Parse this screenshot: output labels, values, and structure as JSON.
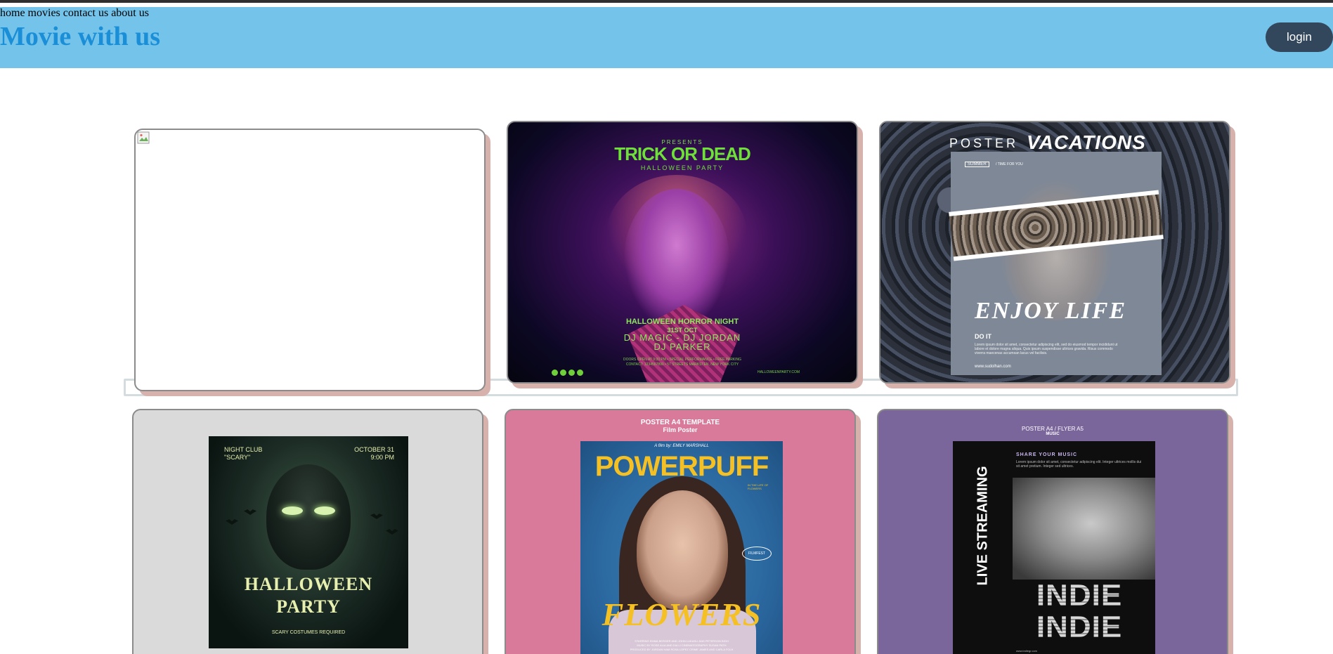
{
  "header": {
    "brand": "Movie with us",
    "nav": [
      {
        "label": "home"
      },
      {
        "label": "movies"
      },
      {
        "label": "contact us"
      },
      {
        "label": "about us"
      }
    ],
    "login_label": "login",
    "colors": {
      "bar": "#74c3ea",
      "brand": "#1a8fd8",
      "nav": "#2a62b0",
      "login_bg": "#33475c"
    }
  },
  "posters": [
    {
      "kind": "broken-image"
    },
    {
      "kind": "trick-or-dead",
      "presents": "PRESENTS",
      "title": "TRICK OR DEAD",
      "subtitle": "HALLOWEEN PARTY",
      "event": "HALLOWEEN HORROR NIGHT",
      "date": "31ST OCT",
      "djs": "DJ MAGIC - DJ JORDAN",
      "dj3": "DJ PARKER",
      "fineprint1": "DOORS OPEN AT 9:00 PM • SPECIAL PERFORMANCE • FREE PARKING",
      "fineprint2": "CONTACT: 1234567890 • 57 STREETS MARKSTEN, NEW YORK CITY",
      "site": "HALLOWEENPARTY.COM"
    },
    {
      "kind": "vacations",
      "word1": "POSTER",
      "word2": "VACATIONS",
      "tag": "SUMMER",
      "tagline": "/ TIME FOR YOU",
      "headline": "ENJOY LIFE",
      "cta": "DO IT",
      "body": "Lorem ipsum dolor sit amet, consectetur adipiscing elit, sed do eiusmod tempor incididunt ut labore et dolore magna aliqua. Quis ipsum suspendisse ultrices gravida. Risus commodo viverra maecenas accumsan lacus vel facilisis.",
      "site": "www.sudolhan.com"
    },
    {
      "kind": "halloween-party",
      "club": "NIGHT CLUB",
      "scary": "\"SCARY\"",
      "date": "OCTOBER 31",
      "time": "9:00 PM",
      "line1": "HALLOWEEN",
      "line2": "PARTY",
      "footer": "SCARY COSTUMES REQUIRED"
    },
    {
      "kind": "powerpuff",
      "header1": "POSTER A4 TEMPLATE",
      "header2": "Film Poster",
      "byline": "A film by: EMILY MARSHALL",
      "title1": "POWERPUFF",
      "title2": "FLOWERS",
      "side": "IN THE LIFE OF FLOWERS",
      "badge": "FILMFEST",
      "credits1": "STARRING EMMA BERGER AND JOHN LUKASLI AND PETERSON BIGH",
      "credits2": "MUSIC BY ROSE ALIA AND DIA LI   CINEMATOGRAPHY SUSAN PATH",
      "credits3": "PRODUCED BY JORDAN HAM   ROSA LOPEZ CRIME JAMES AND CARLA FOLK"
    },
    {
      "kind": "indie",
      "header1": "POSTER A4 / FLYER A5",
      "header2": "MUSIC",
      "vertical": "LIVE STREAMING",
      "share": "SHARE YOUR MUSIC",
      "blurb": "Lorem ipsum dolor sit amet, consectetur adipiscing elit. Integer ultrices mollis dui sit amet pretium. Integer sed ultrices.",
      "indie1": "INDIE",
      "indie2": "INDIE",
      "footer": "www.indiegr.com"
    }
  ]
}
